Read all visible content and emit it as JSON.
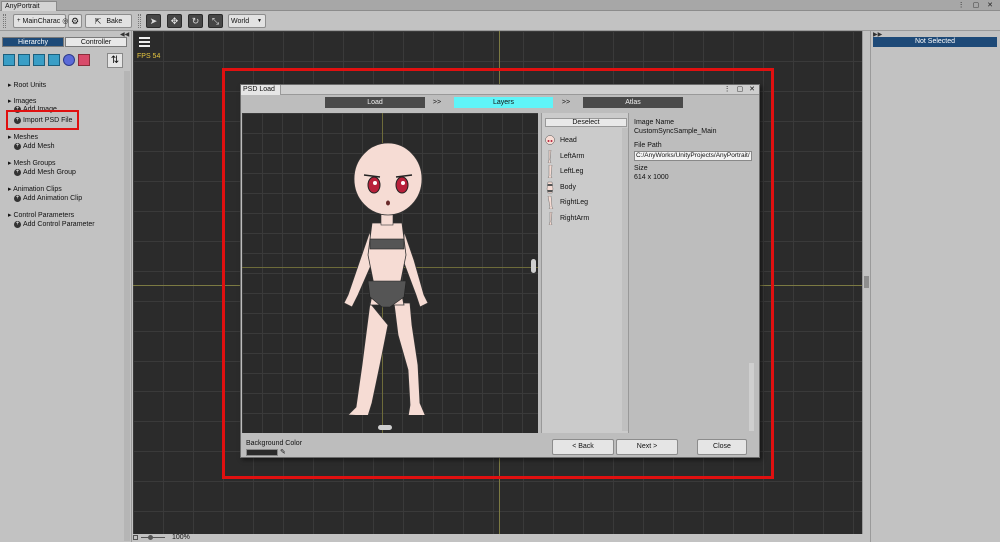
{
  "window": {
    "tab_title": "AnyPortrait",
    "controls": "⋮ ▢ ✕"
  },
  "toolbar": {
    "portrait_selector": "MainCharac",
    "bake_label": "Bake",
    "space_mode": "World",
    "tool_icons": [
      "select-icon",
      "move-icon",
      "rotate-icon",
      "scale-icon"
    ]
  },
  "left_panel": {
    "tabs": [
      "Hierarchy",
      "Controller"
    ],
    "sections": [
      {
        "title": "Root Units",
        "actions": []
      },
      {
        "title": "Images",
        "actions": [
          "Add Image",
          "Import PSD File"
        ]
      },
      {
        "title": "Meshes",
        "actions": [
          "Add Mesh"
        ]
      },
      {
        "title": "Mesh Groups",
        "actions": [
          "Add Mesh Group"
        ]
      },
      {
        "title": "Animation Clips",
        "actions": [
          "Add Animation Clip"
        ]
      },
      {
        "title": "Control Parameters",
        "actions": [
          "Add Control Parameter"
        ]
      }
    ]
  },
  "viewport": {
    "fps": "FPS 54",
    "zoom": "100%"
  },
  "right_panel": {
    "header": "Not Selected"
  },
  "dialog": {
    "title": "PSD Load",
    "steps": [
      "Load",
      ">>",
      "Layers",
      ">>",
      "Atlas"
    ],
    "active_step": "Layers",
    "deselect_label": "Deselect",
    "layers": [
      "Head",
      "LeftArm",
      "LeftLeg",
      "Body",
      "RightLeg",
      "RightArm"
    ],
    "info": {
      "image_name_label": "Image Name",
      "image_name": "CustomSyncSample_Main",
      "file_path_label": "File Path",
      "file_path": "C:/AnyWorks/UnityProjects/AnyPortrait/",
      "size_label": "Size",
      "size": "614 x 1000"
    },
    "background_color_label": "Background Color",
    "buttons": {
      "back": "< Back",
      "next": "Next >",
      "close": "Close"
    }
  },
  "colors": {
    "highlight_red": "#e01010",
    "active_step": "#5ff4f8",
    "step_inactive": "#4a4a4a",
    "panel_header": "#1e4a78"
  }
}
